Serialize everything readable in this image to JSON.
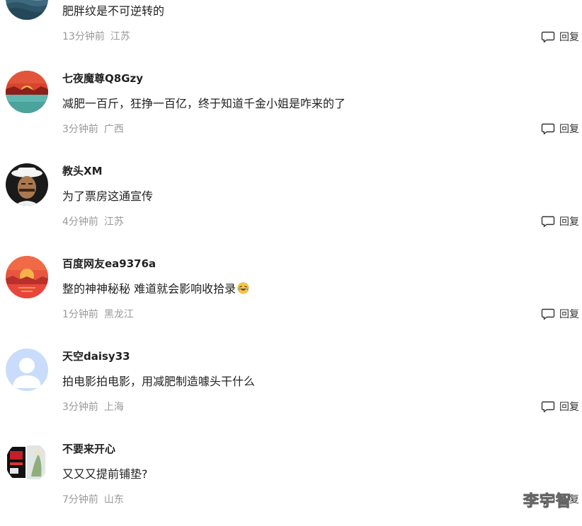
{
  "comments": [
    {
      "username": "",
      "content": "肥胖纹是不可逆转的",
      "time": "13分钟前",
      "location": "江苏",
      "reply_label": "回复",
      "avatar": "ocean-waves-avatar"
    },
    {
      "username": "七夜魔尊Q8Gzy",
      "content": "减肥一百斤，狂挣一百亿，终于知道千金小姐是咋来的了",
      "time": "3分钟前",
      "location": "广西",
      "reply_label": "回复",
      "avatar": "red-sunset-sea-avatar"
    },
    {
      "username": "教头XM",
      "content": "为了票房这通宣传",
      "time": "4分钟前",
      "location": "江苏",
      "reply_label": "回复",
      "avatar": "man-in-hat-avatar"
    },
    {
      "username": "百度网友ea9376a",
      "content": "整的神神秘秘 难道就会影响收拾录",
      "time": "1分钟前",
      "location": "黑龙江",
      "reply_label": "回复",
      "avatar": "orange-sunset-avatar",
      "emoji": "laughing-emoji"
    },
    {
      "username": "天空daisy33",
      "content": "拍电影拍电影，用减肥制造噱头干什么",
      "time": "3分钟前",
      "location": "上海",
      "reply_label": "回复",
      "avatar": "default-person-avatar"
    },
    {
      "username": "不要来开心",
      "content": "又又又提前铺垫?",
      "time": "7分钟前",
      "location": "山东",
      "reply_label": "回复",
      "avatar": "collage-photo-avatar"
    }
  ],
  "watermark": "李宇智",
  "colors": {
    "meta_text": "#999999",
    "body_text": "#222222",
    "default_avatar_bg": "#c9dcfb"
  }
}
